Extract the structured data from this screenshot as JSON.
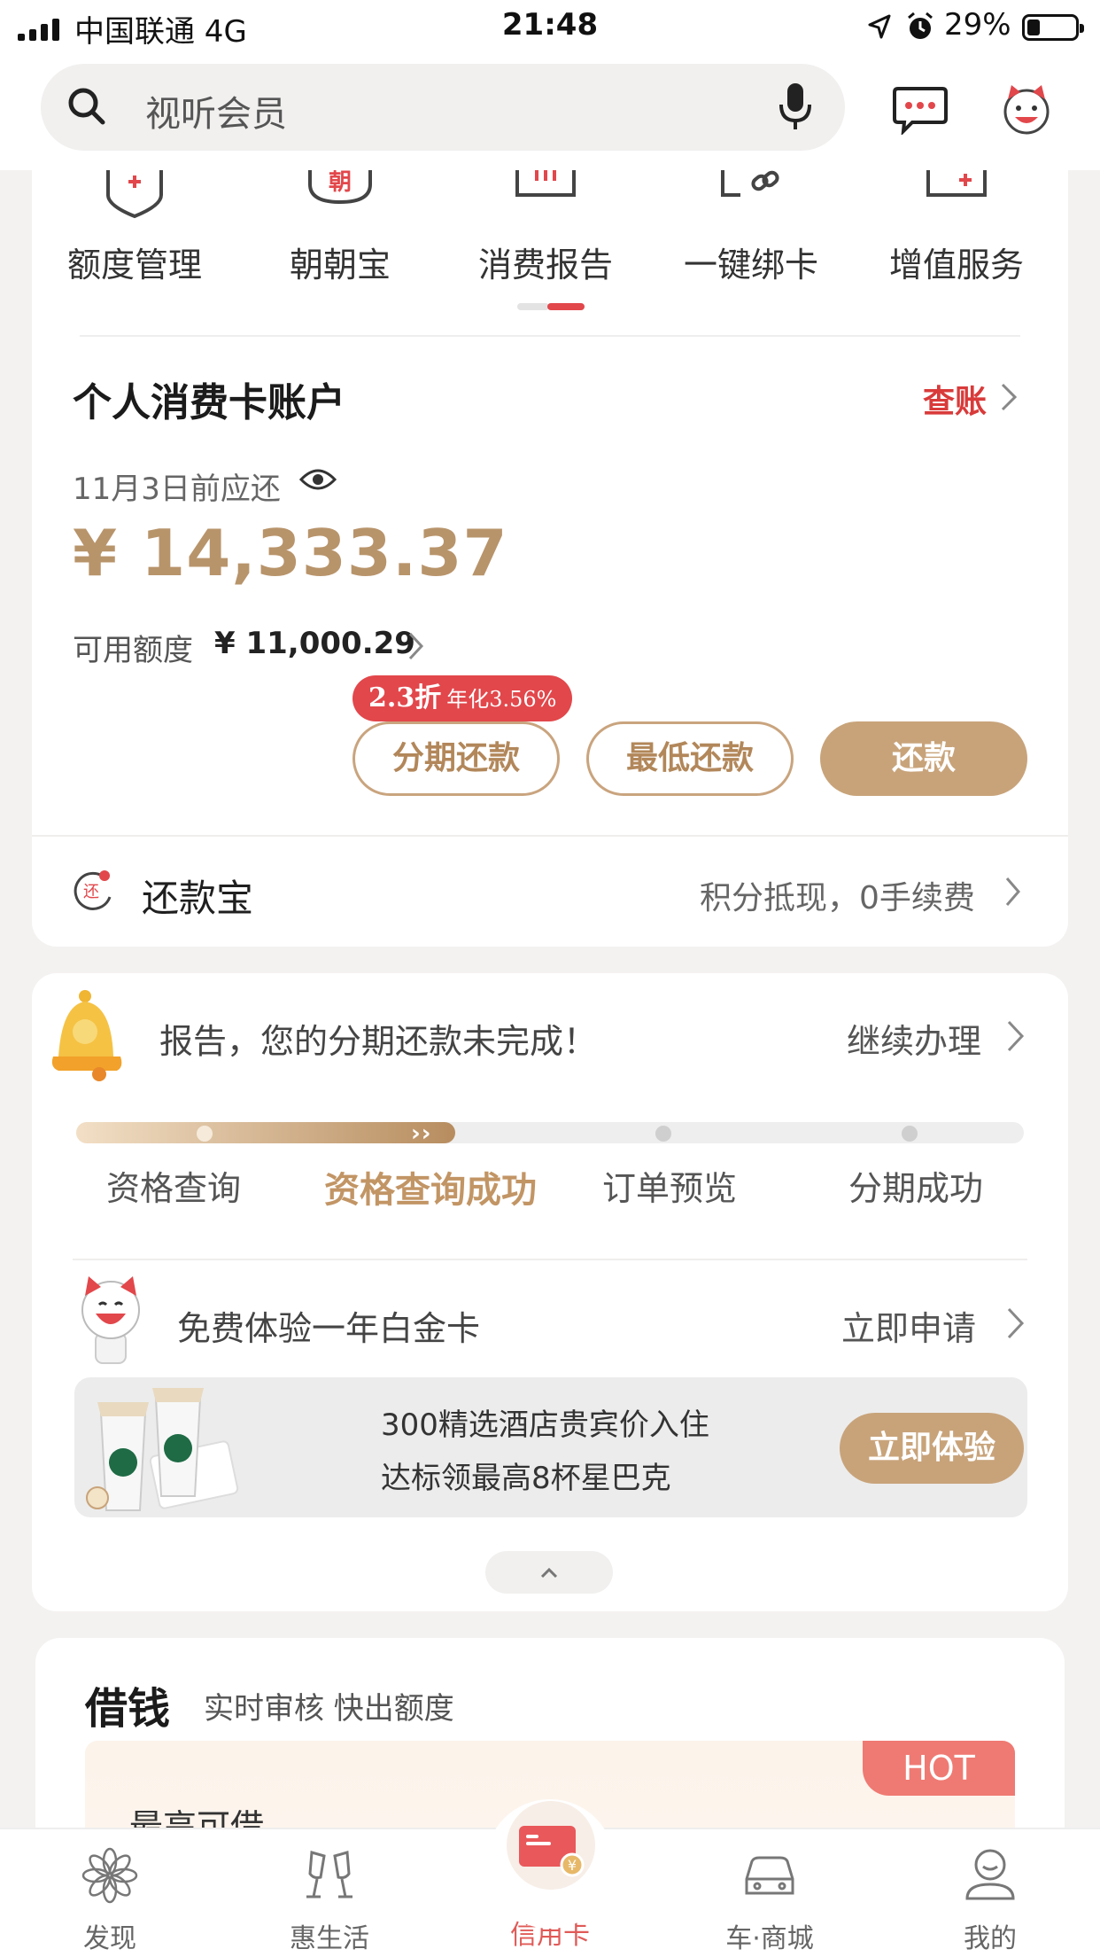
{
  "status_bar": {
    "carrier": "中国联通  4G",
    "time": "21:48",
    "battery": "29%"
  },
  "search": {
    "placeholder": "视听会员"
  },
  "quick_menu": {
    "items": [
      {
        "label": "额度管理",
        "icon": "shield-plus-icon"
      },
      {
        "label": "朝朝宝",
        "icon": "zhao-badge-icon",
        "icon_text": "朝"
      },
      {
        "label": "消费报告",
        "icon": "report-icon"
      },
      {
        "label": "一键绑卡",
        "icon": "link-icon"
      },
      {
        "label": "增值服务",
        "icon": "plus-box-icon"
      }
    ]
  },
  "account": {
    "title": "个人消费卡账户",
    "bill_link": "查账",
    "due_text": "11月3日前应还",
    "amount": "¥ 14,333.37",
    "available_label": "可用额度",
    "available_value": "¥ 11,000.29",
    "promo_main": "2.3折",
    "promo_sub": "年化3.56%",
    "buttons": {
      "installment": "分期还款",
      "minimum": "最低还款",
      "pay": "还款"
    }
  },
  "repay_treasure": {
    "icon_text": "还",
    "title": "还款宝",
    "desc": "积分抵现，0手续费"
  },
  "installment": {
    "notice": "报告，您的分期还款未完成！",
    "continue": "继续办理",
    "progress_fraction": 0.4,
    "steps": [
      "资格查询",
      "资格查询成功",
      "订单预览",
      "分期成功"
    ],
    "active_step": 1,
    "platinum": "免费体验一年白金卡",
    "apply": "立即申请",
    "banner_line1": "300精选酒店贵宾价入住",
    "banner_line2": "达标领最高8杯星巴克",
    "banner_button": "立即体验"
  },
  "borrow": {
    "title": "借钱",
    "subtitle": "实时审核 快出额度",
    "hot": "HOT",
    "max_label": "最高可借"
  },
  "tabs": [
    {
      "label": "发现",
      "icon": "discover-flower-icon"
    },
    {
      "label": "惠生活",
      "icon": "cheers-glasses-icon"
    },
    {
      "label": "信用卡",
      "icon": "credit-card-icon",
      "active": true
    },
    {
      "label": "车·商城",
      "icon": "car-icon"
    },
    {
      "label": "我的",
      "icon": "profile-icon"
    }
  ],
  "colors": {
    "gold": "#b8946b",
    "button_gold": "#c8a37a",
    "red": "#d93a3a",
    "promo_red": "#e2474b"
  }
}
